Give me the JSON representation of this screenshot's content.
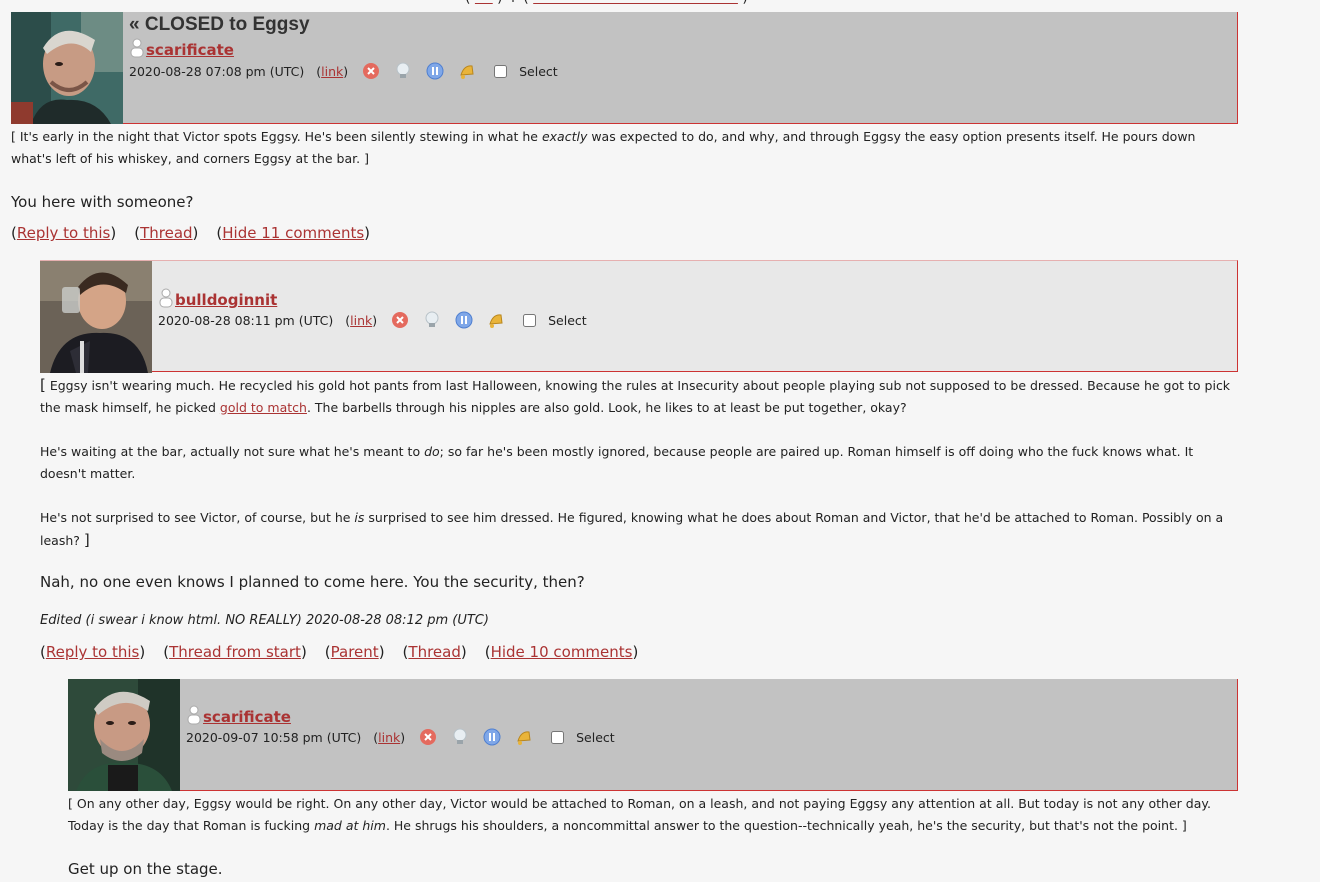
{
  "top_nav": {
    "text": "( ) ↑ ( )"
  },
  "comments": [
    {
      "subject": "« CLOSED to Eggsy",
      "user": "scarificate",
      "date": "2020-08-28 07:08 pm (UTC)",
      "link_label": "link",
      "select_label": "Select",
      "body_1_a": "[ It's early in the night that Victor spots Eggsy. He's been silently stewing in what he ",
      "body_1_em": "exactly",
      "body_1_b": " was expected to do, and why, and through Eggsy the easy option presents itself. He pours down what's left of his whiskey, and corners Eggsy at the bar. ]",
      "speech": "You here with someone?",
      "actions": [
        "Reply to this",
        "Thread",
        "Hide 11 comments"
      ]
    },
    {
      "user": "bulldoginnit",
      "date": "2020-08-28 08:11 pm (UTC)",
      "link_label": "link",
      "select_label": "Select",
      "p1_a": "Eggsy isn't wearing much. He recycled his gold hot pants from last Halloween, knowing the rules at Insecurity about people playing sub not supposed to be dressed. Because he got to pick the mask himself, he picked ",
      "p1_link": "gold to match",
      "p1_b": ". The barbells through his nipples are also gold. Look, he likes to at least be put together, okay?",
      "p2_a": "He's waiting at the bar, actually not sure what he's meant to ",
      "p2_em": "do",
      "p2_b": "; so far he's been mostly ignored, because people are paired up. Roman himself is off doing who the fuck knows what. It doesn't matter.",
      "p3_a": "He's not surprised to see Victor, of course, but he ",
      "p3_em": "is",
      "p3_b": " surprised to see him dressed. He figured, knowing what he does about Roman and Victor, that he'd be attached to Roman. Possibly on a leash? ",
      "speech": "Nah, no one even knows I planned to come here. You the security, then?",
      "edited": "Edited (i swear i know html. NO REALLY) 2020-08-28 08:12 pm (UTC)",
      "actions": [
        "Reply to this",
        "Thread from start",
        "Parent",
        "Thread",
        "Hide 10 comments"
      ]
    },
    {
      "user": "scarificate",
      "date": "2020-09-07 10:58 pm (UTC)",
      "link_label": "link",
      "select_label": "Select",
      "body_a": "[ On any other day, Eggsy would be right. On any other day, Victor would be attached to Roman, on a leash, and not paying Eggsy any attention at all. But today is not any other day. Today is the day that Roman is fucking ",
      "body_em": "mad at him",
      "body_b": ". He shrugs his shoulders, a noncommittal answer to the question--technically yeah, he's the security, but that's not the point. ]",
      "speech": "Get up on the stage."
    }
  ],
  "icons": [
    "user-icon",
    "delete-icon",
    "screen-icon",
    "freeze-icon",
    "track-icon"
  ],
  "colors": {
    "link": "#aa3333",
    "header_dark": "#c2c2c2",
    "header_light": "#e8e8e8",
    "border": "#cc3333"
  }
}
